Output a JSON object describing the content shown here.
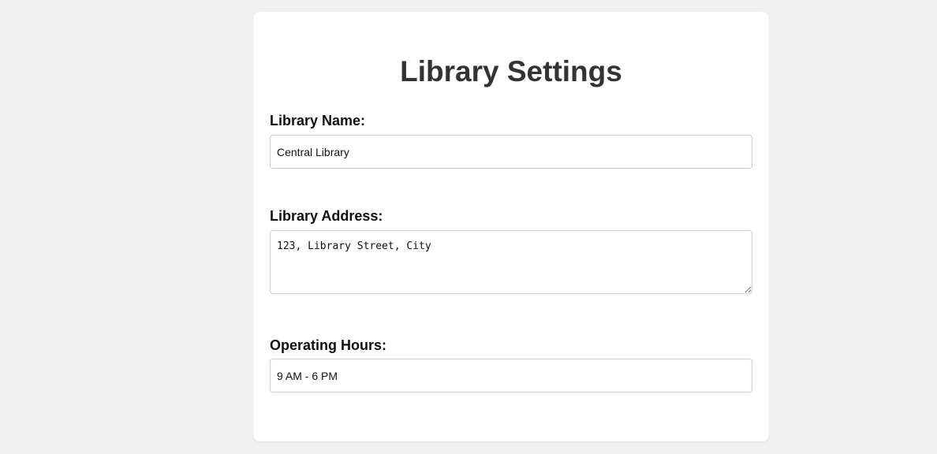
{
  "page": {
    "title": "Library Settings"
  },
  "form": {
    "library_name": {
      "label": "Library Name:",
      "value": "Central Library"
    },
    "library_address": {
      "label": "Library Address:",
      "value": "123, Library Street, City"
    },
    "operating_hours": {
      "label": "Operating Hours:",
      "value": "9 AM - 6 PM"
    }
  },
  "colors": {
    "background": "#f0f0f0",
    "card": "#ffffff",
    "title": "#333333",
    "border": "#cfcfcf"
  }
}
